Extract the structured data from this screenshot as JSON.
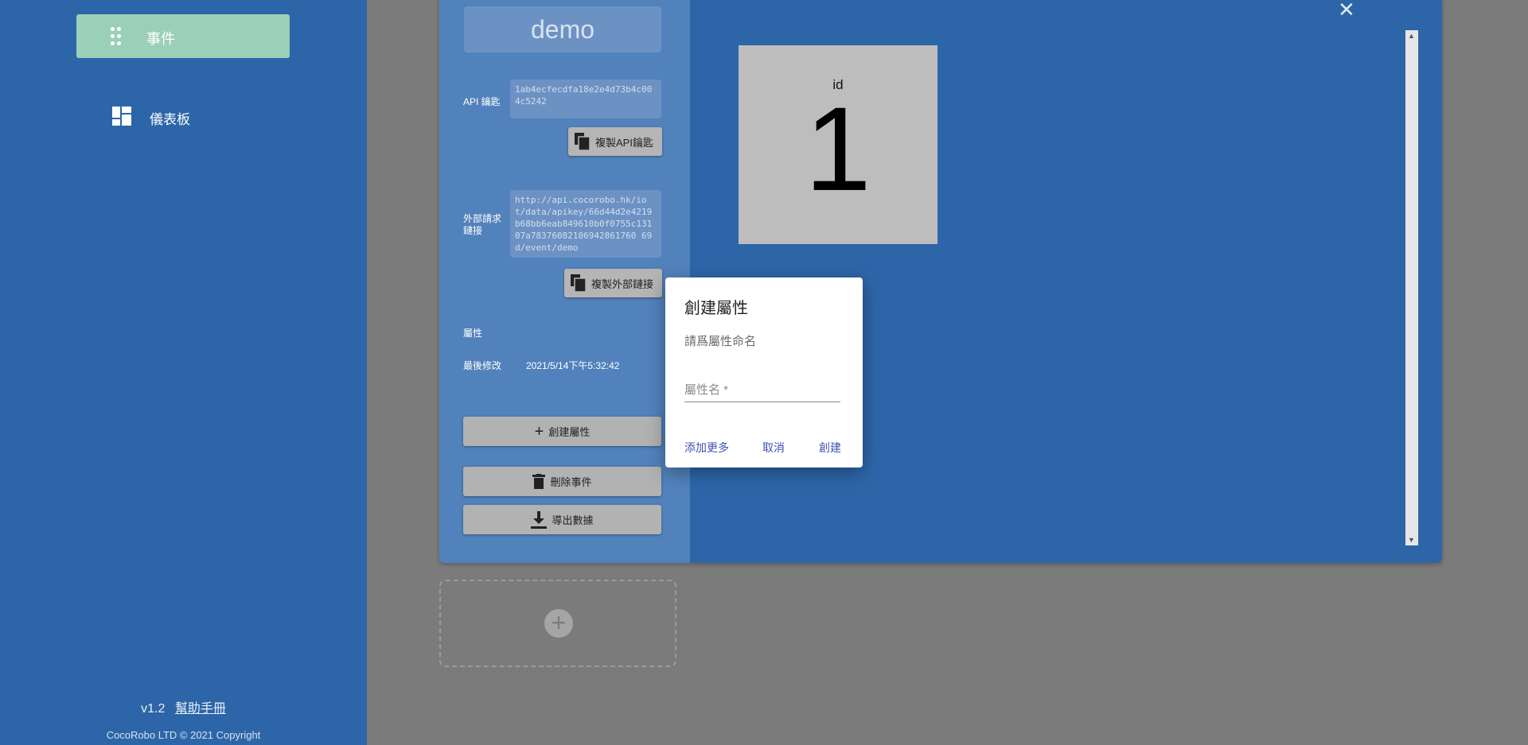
{
  "sidebar": {
    "active_item": {
      "label": "事件",
      "icon": "drag-dots-icon",
      "color": "#9bd0b8"
    },
    "items": [
      {
        "label": "儀表板",
        "icon": "dashboard-icon"
      }
    ],
    "version": "v1.2",
    "help_link": "幫助手冊",
    "copyright": "CocoRobo LTD © 2021 Copyright"
  },
  "event": {
    "name": "demo",
    "api_key_label": "API 鑰匙",
    "api_key": "1ab4ecfecdfa18e2e4d73b4c004c5242",
    "copy_api_key_label": "複製API鑰匙",
    "external_url_label": "外部請求\n鏈接",
    "external_url": "http://api.cocorobo.hk/iot/data/apikey/66d44d2e4219b68bb6eab849610b0f0755c13107a78376082106942861760 69d/event/demo",
    "copy_external_url_label": "複製外部鏈接",
    "attributes_label": "屬性",
    "last_modified_label": "最後修改",
    "last_modified_value": "2021/5/14下午5:32:42",
    "create_attribute_label": "創建屬性",
    "delete_event_label": "刪除事件",
    "export_data_label": "導出數據"
  },
  "widget": {
    "label": "id",
    "value": "1"
  },
  "dialog": {
    "title": "創建屬性",
    "subtitle": "請爲屬性命名",
    "input_placeholder": "屬性名 *",
    "input_value": "",
    "add_more_label": "添加更多",
    "cancel_label": "取消",
    "create_label": "創建"
  },
  "colors": {
    "sidebar": "#2d66a8",
    "accent": "#3f51b5",
    "overlay": "#7b7b7b"
  }
}
